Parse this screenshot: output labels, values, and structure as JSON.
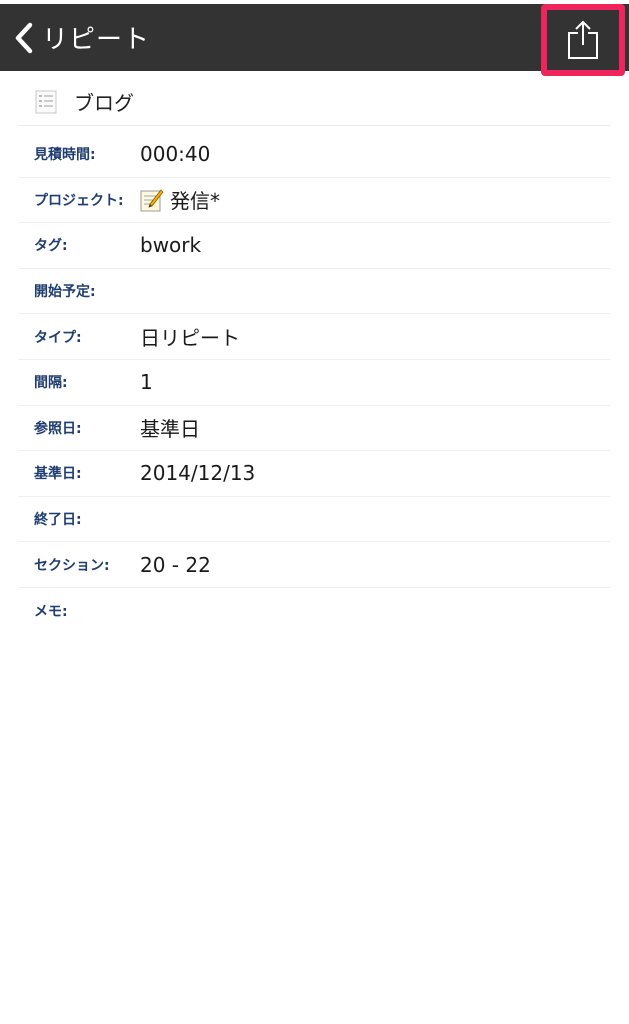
{
  "navbar": {
    "back_label": "リピート",
    "back_icon": "chevron-left-icon",
    "share_icon": "share-icon",
    "highlight_color": "#f0245c",
    "background_color": "#333333"
  },
  "task": {
    "title": "ブログ",
    "title_icon": "list-icon"
  },
  "fields": [
    {
      "label": "見積時間:",
      "value": "000:40"
    },
    {
      "label": "プロジェクト:",
      "value": "発信*",
      "icon": "memo-pencil-icon"
    },
    {
      "label": "タグ:",
      "value": "bwork"
    },
    {
      "label": "開始予定:",
      "value": ""
    },
    {
      "label": "タイプ:",
      "value": "日リピート"
    },
    {
      "label": "間隔:",
      "value": "1"
    },
    {
      "label": "参照日:",
      "value": "基準日"
    },
    {
      "label": "基準日:",
      "value": "2014/12/13"
    },
    {
      "label": "終了日:",
      "value": ""
    },
    {
      "label": "セクション:",
      "value": "20 - 22"
    },
    {
      "label": "メモ:",
      "value": ""
    }
  ]
}
